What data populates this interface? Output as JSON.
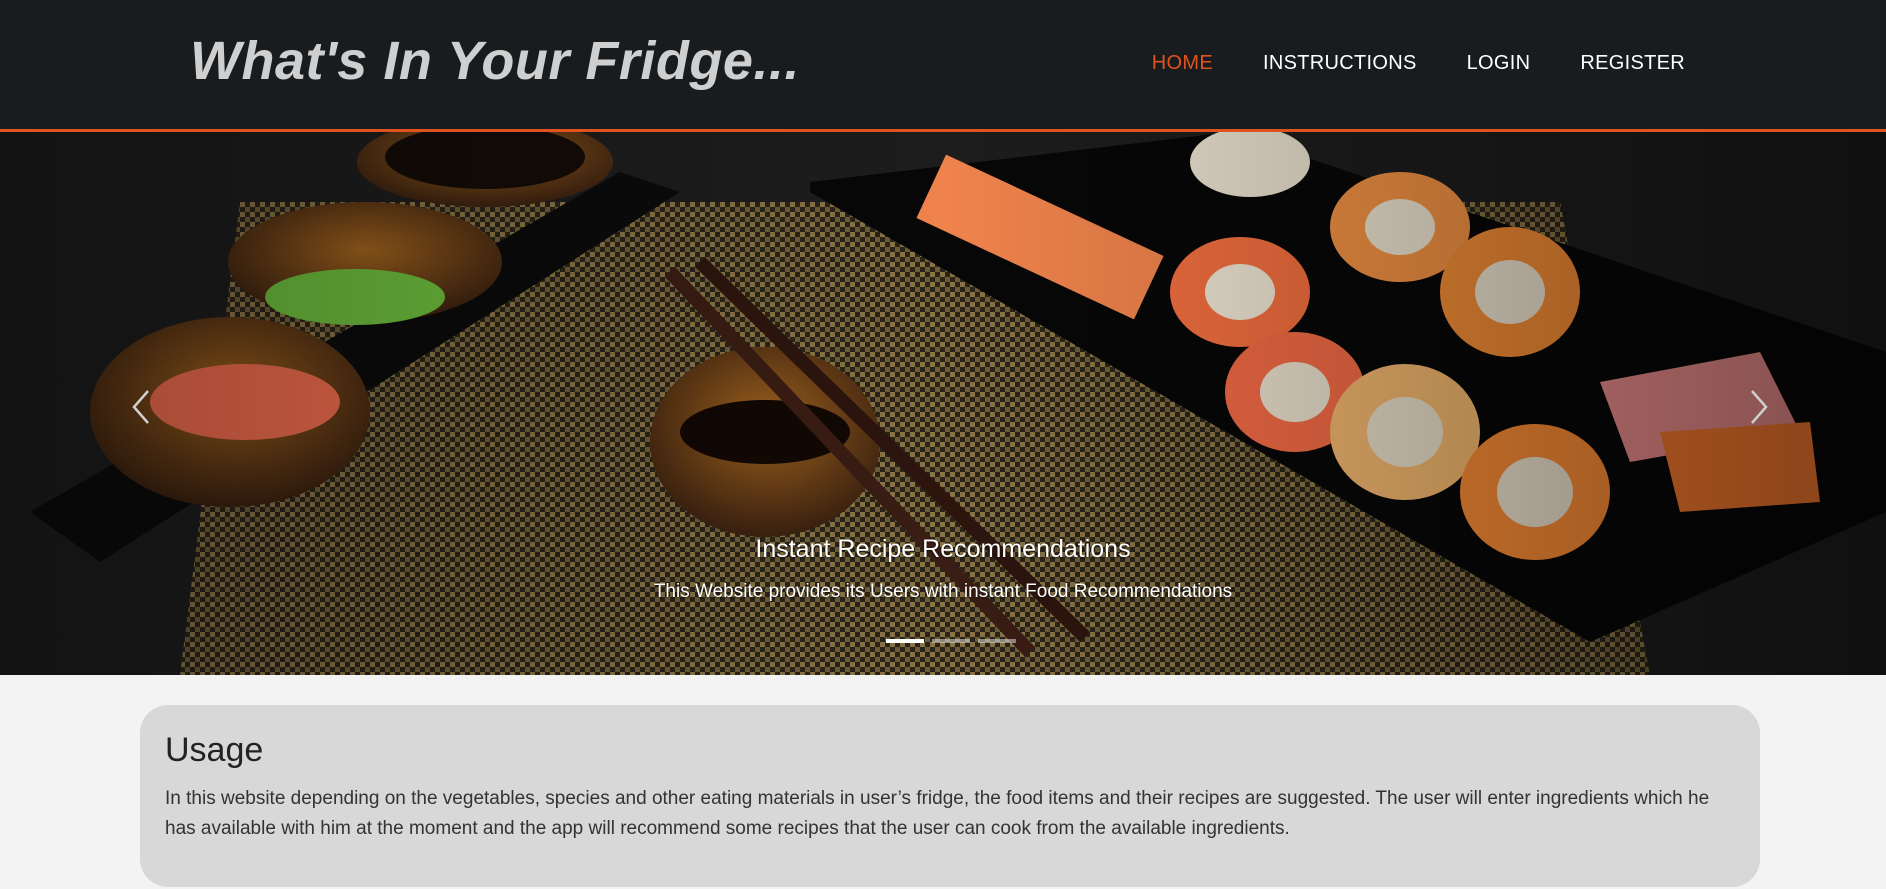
{
  "header": {
    "brand": "What's In Your Fridge...",
    "nav": [
      {
        "label": "HOME",
        "active": true
      },
      {
        "label": "INSTRUCTIONS",
        "active": false
      },
      {
        "label": "LOGIN",
        "active": false
      },
      {
        "label": "REGISTER",
        "active": false
      }
    ]
  },
  "carousel": {
    "caption_title": "Instant Recipe Recommendations",
    "caption_text": "This Website provides its Users with instant Food Recommendations",
    "slide_count": 3,
    "active_slide": 1,
    "prev_icon": "chevron-left-icon",
    "next_icon": "chevron-right-icon"
  },
  "usage": {
    "heading": "Usage",
    "text": "In this website depending on the vegetables, species and other eating materials in user’s fridge, the food items and their recipes are suggested. The user will enter ingredients which he has available with him at the moment and the app will recommend some recipes that the user can cook from the available ingredients."
  },
  "colors": {
    "accent": "#e0531f",
    "navbar_bg": "#181c1f",
    "brand_text": "#cfcfcf",
    "usage_card_bg": "#d8d8d8",
    "page_bg": "#f3f3f3"
  }
}
